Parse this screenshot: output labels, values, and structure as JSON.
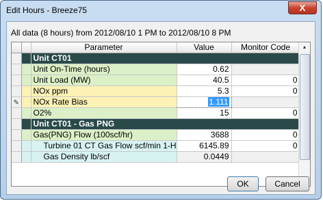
{
  "window": {
    "title": "Edit Hours - Breeze75",
    "close_label": "X"
  },
  "info_text": "All data (8 hours) from 2012/08/10 1 PM to 2012/08/10 8 PM",
  "grid": {
    "columns": [
      "Parameter",
      "Value",
      "Monitor Code"
    ],
    "rows": {
      "sec1": "Unit CT01",
      "r1": {
        "label": "Unit On-Time (hours)",
        "value": "0.62",
        "code": ""
      },
      "r2": {
        "label": "Unit Load (MW)",
        "value": "40.5",
        "code": "0"
      },
      "r3": {
        "label": "NOx ppm",
        "value": "5.3",
        "code": "0"
      },
      "r4": {
        "label": "NOx Rate Bias",
        "value": "1.111",
        "code": ""
      },
      "r5": {
        "label": "O2%",
        "value": "15",
        "code": "0"
      },
      "sec2": "Unit CT01 - Gas PNG",
      "r6": {
        "label": "Gas(PNG) Flow (100scf/hr)",
        "value": "3688",
        "code": "0"
      },
      "r7": {
        "label": "Turbine 01 CT Gas Flow scf/min 1-Hr",
        "value": "6145.89",
        "code": "0"
      },
      "r8": {
        "label": "Gas Density lb/scf",
        "value": "0.0449",
        "code": ""
      }
    },
    "editing_row_icon": "pencil-icon"
  },
  "buttons": {
    "ok": "OK",
    "cancel": "Cancel"
  },
  "colors": {
    "section_bg": "#2a4a4a",
    "green_label": "#dbf0c6",
    "yellow_label": "#fdf2b5",
    "cyan_label": "#d8f2f2",
    "selection": "#3399ff"
  }
}
